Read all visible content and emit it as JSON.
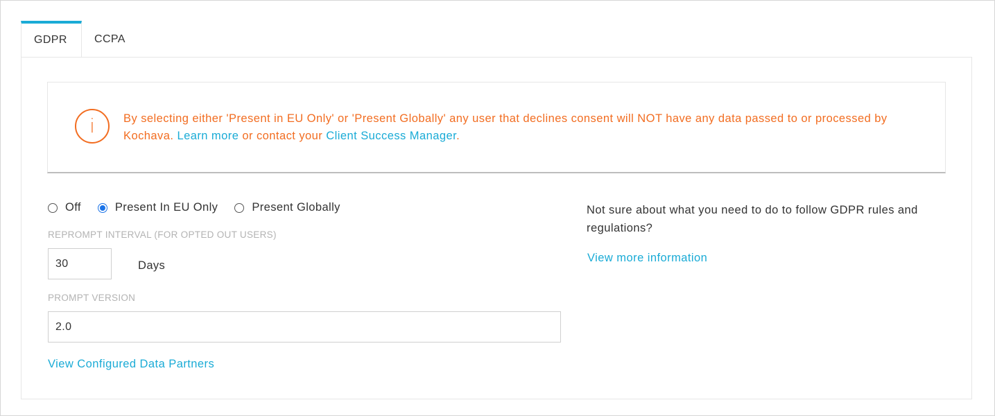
{
  "tabs": [
    {
      "label": "GDPR",
      "active": true
    },
    {
      "label": "CCPA",
      "active": false
    }
  ],
  "alert": {
    "icon": "info-icon",
    "icon_glyph": "i",
    "text_before": "By selecting either 'Present in EU Only' or 'Present Globally' any user that declines consent will NOT have any data passed to or processed by Kochava. ",
    "learn_more": "Learn more",
    "text_middle": " or contact your ",
    "csm": "Client Success Manager",
    "text_end": ".",
    "color": "#f26d21"
  },
  "consent": {
    "options": [
      {
        "label": "Off",
        "checked": false
      },
      {
        "label": "Present In EU Only",
        "checked": true
      },
      {
        "label": "Present Globally",
        "checked": false
      }
    ]
  },
  "reprompt": {
    "label": "REPROMPT INTERVAL (FOR OPTED OUT USERS)",
    "value": "30",
    "unit": "Days"
  },
  "prompt_version": {
    "label": "PROMPT VERSION",
    "value": "2.0"
  },
  "partners_link": "View Configured Data Partners",
  "help": {
    "text": "Not sure about what you need to do to follow GDPR rules and regulations?",
    "link": "View more information"
  },
  "colors": {
    "accent": "#1aabd6",
    "warning": "#f26d21",
    "radio_checked": "#1a73e8"
  }
}
